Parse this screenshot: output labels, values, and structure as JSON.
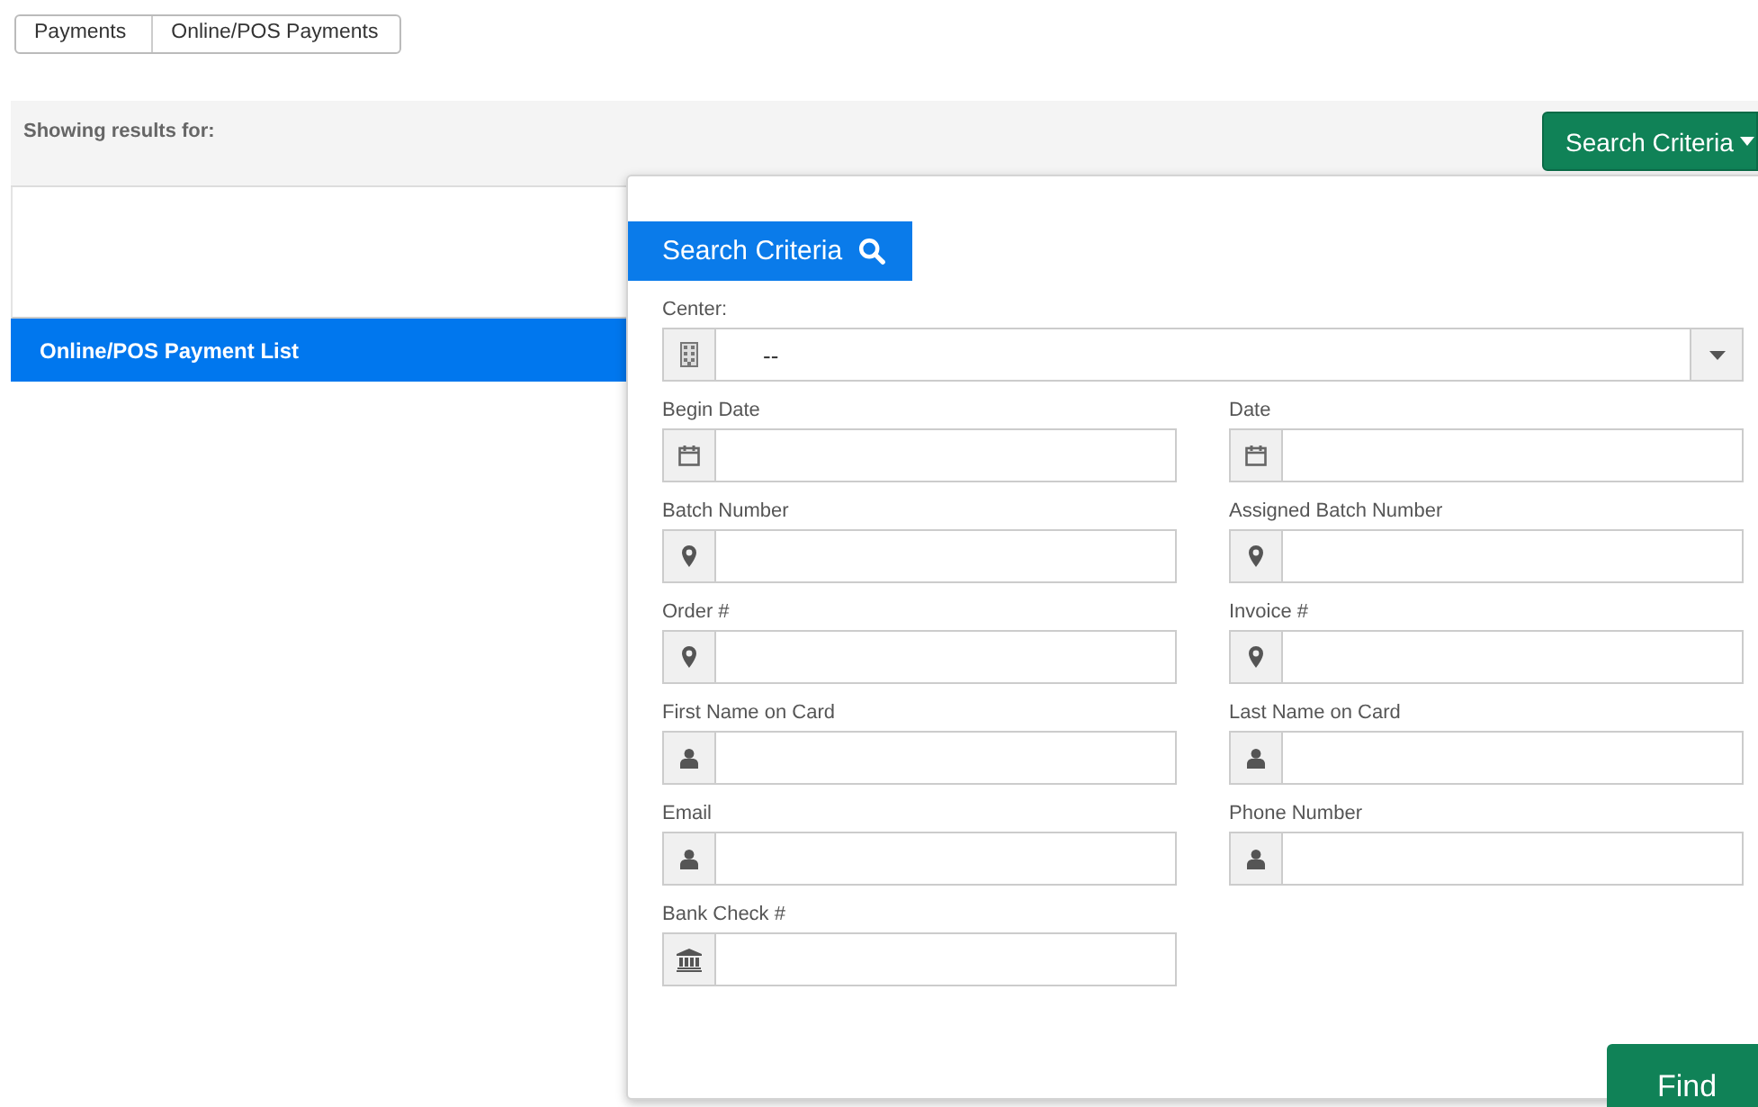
{
  "breadcrumb": [
    {
      "label": "Payments"
    },
    {
      "label": "Online/POS Payments"
    }
  ],
  "results_bar": {
    "label": "Showing results for:",
    "button": "Search Criteria"
  },
  "list_header": "Online/POS Payment List",
  "search_panel": {
    "title": "Search Criteria",
    "center": {
      "label": "Center:",
      "value": "--"
    },
    "fields": [
      {
        "label": "Begin Date",
        "kind": "date"
      },
      {
        "label": "Date",
        "kind": "date"
      },
      {
        "label": "Batch Number",
        "kind": "location"
      },
      {
        "label": "Assigned Batch Number",
        "kind": "location"
      },
      {
        "label": "Order #",
        "kind": "location"
      },
      {
        "label": "Invoice #",
        "kind": "location"
      },
      {
        "label": "First Name on Card",
        "kind": "person"
      },
      {
        "label": "Last Name on Card",
        "kind": "person"
      },
      {
        "label": "Email",
        "kind": "person"
      },
      {
        "label": "Phone Number",
        "kind": "person"
      },
      {
        "label": "Bank Check #",
        "kind": "bank"
      }
    ],
    "find_button": "Find"
  }
}
